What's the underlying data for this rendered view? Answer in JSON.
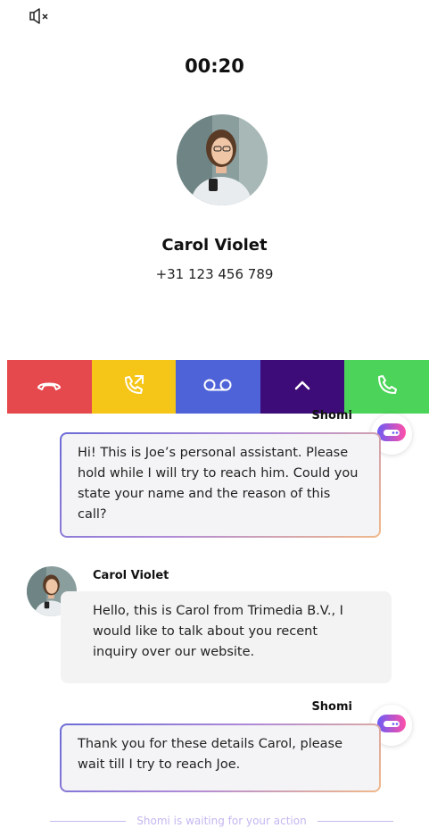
{
  "call": {
    "timer": "00:20",
    "caller_name": "Carol Violet",
    "caller_number": "+31 123 456 789"
  },
  "icons": {
    "mute": "speaker-muted-icon",
    "hangup": "hang-up-phone-icon",
    "forward": "phone-forward-icon",
    "voicemail": "voicemail-icon",
    "expand": "chevron-up-icon",
    "answer": "phone-icon",
    "bot": "chat-bot-icon"
  },
  "colors": {
    "hangup": "#e5484d",
    "forward": "#f5c518",
    "voicemail": "#4f63d9",
    "expand": "#3e0c78",
    "answer": "#4cd45a",
    "bot_gradient_start": "#6b5cf5",
    "bot_gradient_end": "#ff4fa8"
  },
  "chat": {
    "messages": [
      {
        "sender": "Shomi",
        "text": "Hi! This is Joe’s personal assistant. Please hold while I will try to reach him. Could you state your name and the reason of this call?"
      },
      {
        "sender": "Carol Violet",
        "text": "Hello, this is Carol from Trimedia B.V., I would like to talk about you recent inquiry over our website."
      },
      {
        "sender": "Shomi",
        "text": "Thank you for these details Carol, please wait till I try to reach Joe."
      }
    ],
    "status": "Shomi is waiting for your action"
  }
}
